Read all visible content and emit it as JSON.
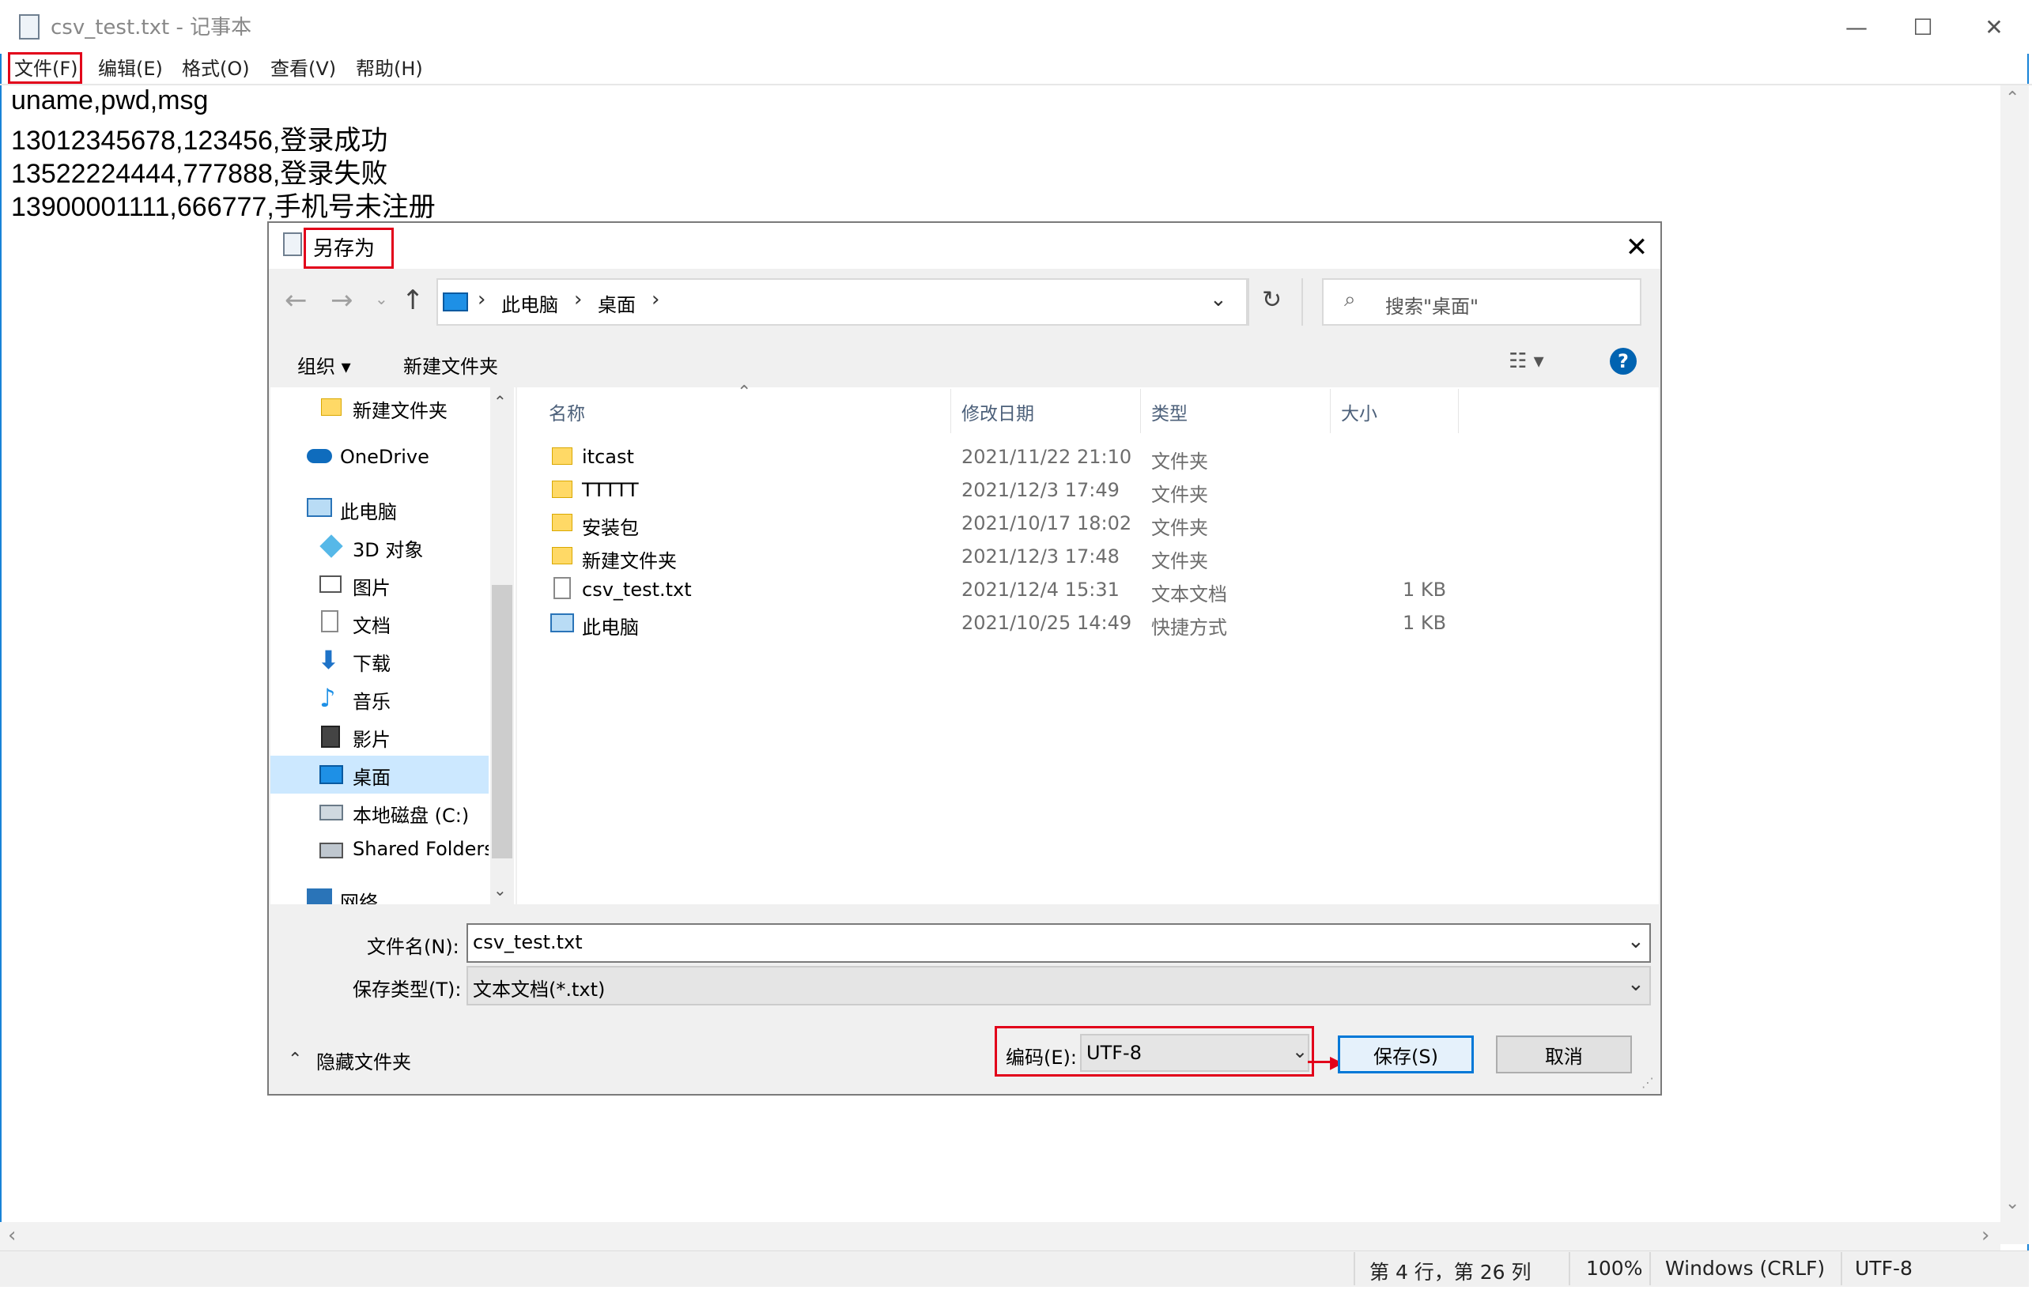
{
  "notepad": {
    "title": "csv_test.txt - 记事本",
    "window_controls": {
      "minimize": "—",
      "maximize": "☐",
      "close": "✕"
    },
    "menu": [
      "文件(F)",
      "编辑(E)",
      "格式(O)",
      "查看(V)",
      "帮助(H)"
    ],
    "lines": [
      "uname,pwd,msg",
      "13012345678,123456,登录成功",
      "13522224444,777888,登录失败",
      "13900001111,666777,手机号未注册"
    ],
    "status": {
      "position": "第 4 行，第 26 列",
      "zoom": "100%",
      "line_ending": "Windows (CRLF)",
      "encoding": "UTF-8"
    }
  },
  "dialog": {
    "title": "另存为",
    "close": "✕",
    "address": {
      "segments": [
        "此电脑",
        "桌面"
      ],
      "sep": "›"
    },
    "search_placeholder": "搜索\"桌面\"",
    "toolbar": {
      "organize": "组织 ▾",
      "new_folder": "新建文件夹",
      "help": "?"
    },
    "tree": [
      {
        "label": "新建文件夹",
        "icon": "folder-icon"
      },
      {
        "label": "OneDrive",
        "icon": "cloud-icon"
      },
      {
        "label": "此电脑",
        "icon": "computer-icon"
      },
      {
        "label": "3D 对象",
        "icon": "cube-icon"
      },
      {
        "label": "图片",
        "icon": "pictures-icon"
      },
      {
        "label": "文档",
        "icon": "document-icon"
      },
      {
        "label": "下载",
        "icon": "download-icon"
      },
      {
        "label": "音乐",
        "icon": "music-icon"
      },
      {
        "label": "影片",
        "icon": "video-icon"
      },
      {
        "label": "桌面",
        "icon": "desktop-icon"
      },
      {
        "label": "本地磁盘 (C:)",
        "icon": "drive-icon"
      },
      {
        "label": "Shared Folders",
        "icon": "network-drive-icon"
      },
      {
        "label": "网络",
        "icon": "network-icon"
      }
    ],
    "columns": [
      "名称",
      "修改日期",
      "类型",
      "大小"
    ],
    "files": [
      {
        "name": "itcast",
        "date": "2021/11/22 21:10",
        "type": "文件夹",
        "size": ""
      },
      {
        "name": "TTTTT",
        "date": "2021/12/3 17:49",
        "type": "文件夹",
        "size": ""
      },
      {
        "name": "安装包",
        "date": "2021/10/17 18:02",
        "type": "文件夹",
        "size": ""
      },
      {
        "name": "新建文件夹",
        "date": "2021/12/3 17:48",
        "type": "文件夹",
        "size": ""
      },
      {
        "name": "csv_test.txt",
        "date": "2021/12/4 15:31",
        "type": "文本文档",
        "size": "1 KB"
      },
      {
        "name": "此电脑",
        "date": "2021/10/25 14:49",
        "type": "快捷方式",
        "size": "1 KB"
      }
    ],
    "filename_label": "文件名(N):",
    "filename_value": "csv_test.txt",
    "filetype_label": "保存类型(T):",
    "filetype_value": "文本文档(*.txt)",
    "hide_folders": "隐藏文件夹",
    "encoding_label": "编码(E):",
    "encoding_value": "UTF-8",
    "save_button": "保存(S)",
    "cancel_button": "取消"
  },
  "colors": {
    "highlight_red": "#e2001a",
    "accent_blue": "#0078d7",
    "selected_bg": "#cce8ff"
  }
}
